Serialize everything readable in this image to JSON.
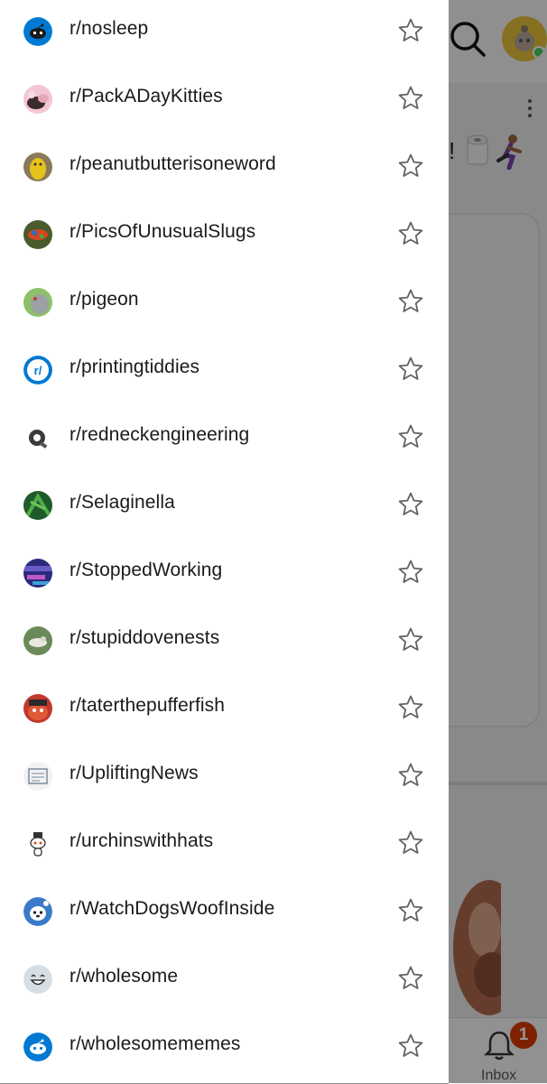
{
  "drawer": {
    "subreddits": [
      {
        "name": "r/nosleep",
        "avatar_icon": "reddit-snoo-dark-icon"
      },
      {
        "name": "r/PackADayKitties",
        "avatar_icon": "kitten-photo-icon"
      },
      {
        "name": "r/peanutbutterisoneword",
        "avatar_icon": "peanut-character-icon"
      },
      {
        "name": "r/PicsOfUnusualSlugs",
        "avatar_icon": "slug-photo-icon"
      },
      {
        "name": "r/pigeon",
        "avatar_icon": "pigeon-photo-icon"
      },
      {
        "name": "r/printingtiddies",
        "avatar_icon": "default-subreddit-icon"
      },
      {
        "name": "r/redneckengineering",
        "avatar_icon": "duct-tape-icon"
      },
      {
        "name": "r/Selaginella",
        "avatar_icon": "fern-photo-icon"
      },
      {
        "name": "r/StoppedWorking",
        "avatar_icon": "glitch-photo-icon"
      },
      {
        "name": "r/stupiddovenests",
        "avatar_icon": "dove-nest-photo-icon"
      },
      {
        "name": "r/taterthepufferfish",
        "avatar_icon": "pufferfish-photo-icon"
      },
      {
        "name": "r/UpliftingNews",
        "avatar_icon": "newspaper-sketch-icon"
      },
      {
        "name": "r/urchinswithhats",
        "avatar_icon": "snoo-with-hat-icon"
      },
      {
        "name": "r/WatchDogsWoofInside",
        "avatar_icon": "dog-snoo-icon"
      },
      {
        "name": "r/wholesome",
        "avatar_icon": "smiley-face-icon"
      },
      {
        "name": "r/wholesomememes",
        "avatar_icon": "reddit-snoo-blue-icon"
      }
    ],
    "favorite_icon": "star-outline-icon"
  },
  "background": {
    "title_fragment": "!",
    "inbox_label": "Inbox",
    "inbox_badge_count": "1",
    "colors": {
      "accent_blue": "#0079d3",
      "badge_orange": "#d93a00",
      "online_green": "#46d160"
    }
  }
}
